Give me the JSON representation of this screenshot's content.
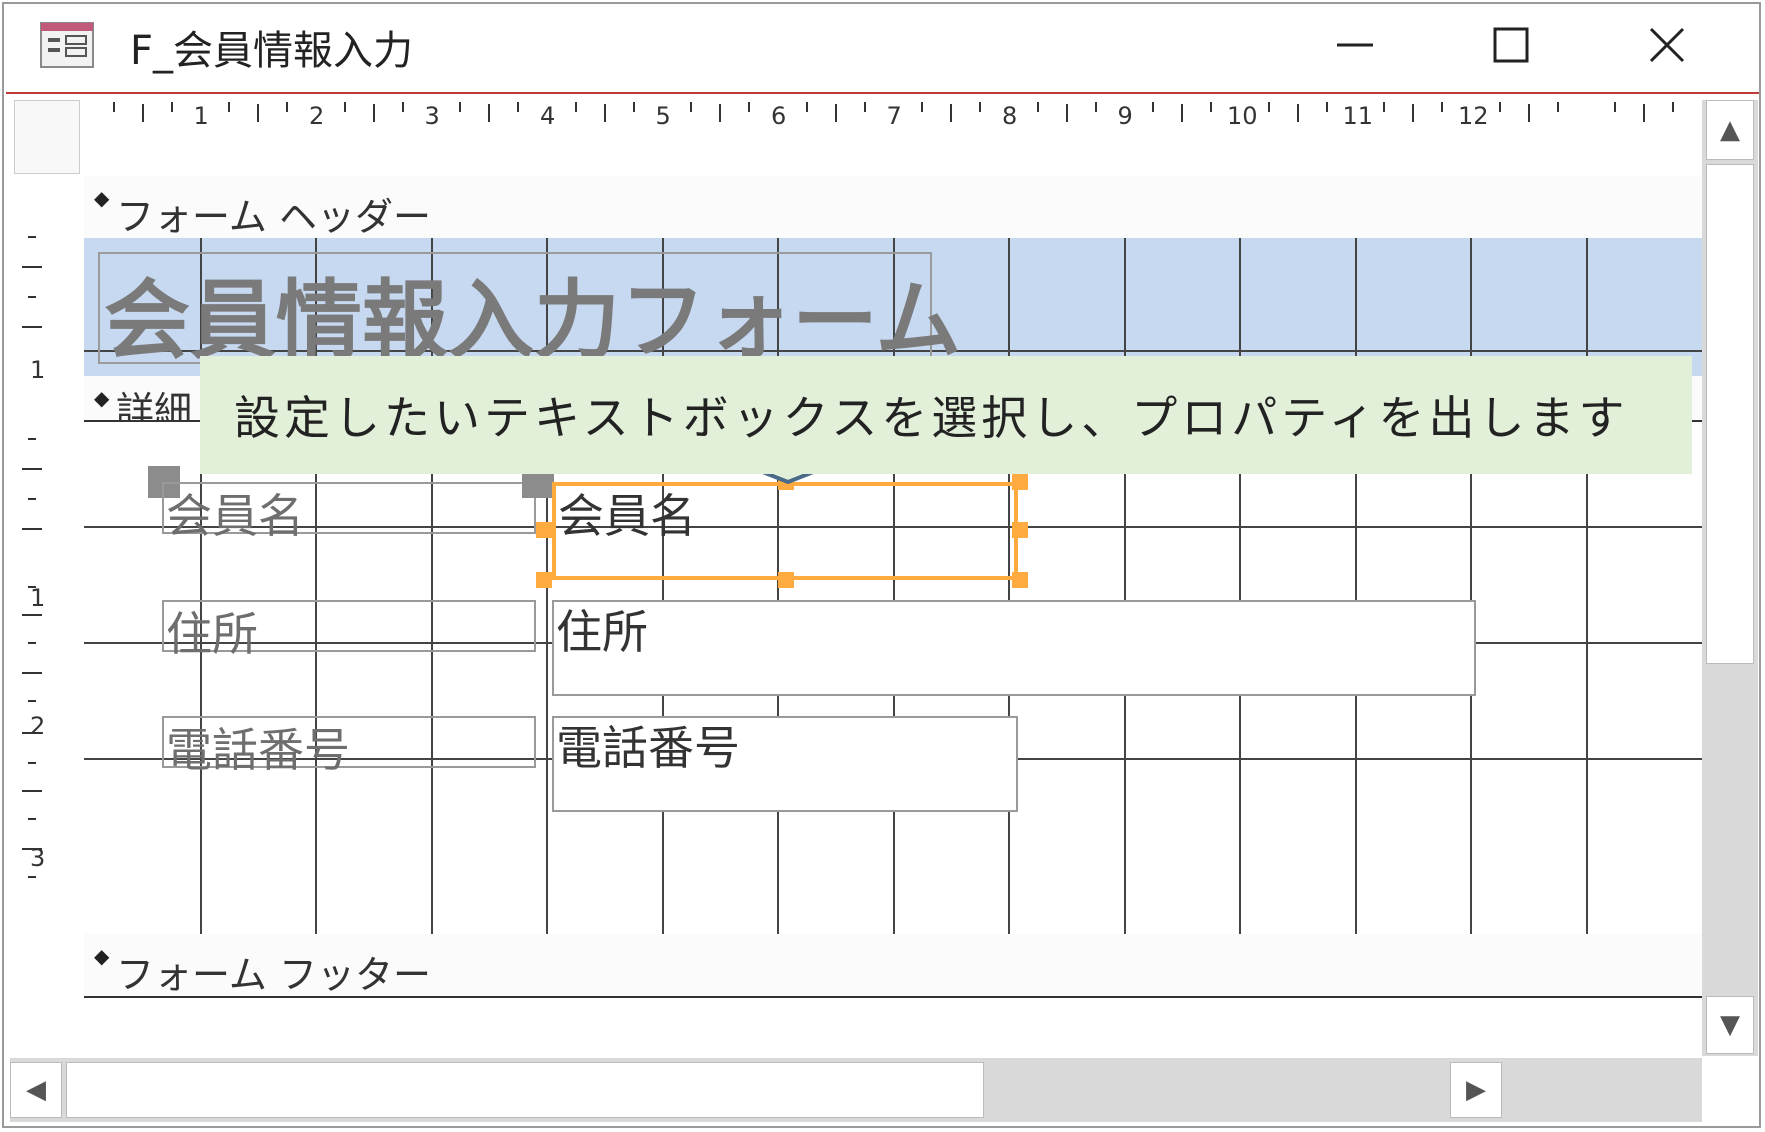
{
  "window": {
    "title": "F_会員情報入力",
    "icon": "form-icon",
    "minimize_glyph": "—",
    "maximize_glyph": "☐",
    "close_glyph": "✕"
  },
  "ruler": {
    "top_labels": [
      "1",
      "2",
      "3",
      "4",
      "5",
      "6",
      "7",
      "8",
      "9",
      "10",
      "11",
      "12"
    ],
    "left_labels": [
      "1",
      "1",
      "2",
      "3"
    ]
  },
  "sections": {
    "header_label": "フォーム ヘッダー",
    "detail_label": "詳細",
    "footer_label": "フォーム フッター"
  },
  "form": {
    "title_label": "会員情報入力フォーム",
    "fields": [
      {
        "label": "会員名",
        "textbox": "会員名"
      },
      {
        "label": "住所",
        "textbox": "住所"
      },
      {
        "label": "電話番号",
        "textbox": "電話番号"
      }
    ]
  },
  "callout": {
    "text": "設定したいテキストボックスを選択し、プロパティを出します"
  },
  "colors": {
    "header_bg": "#c6d9f1",
    "selection": "#ffab40",
    "callout_bg": "#e2efd9",
    "arrow": "#4a6a8a"
  }
}
